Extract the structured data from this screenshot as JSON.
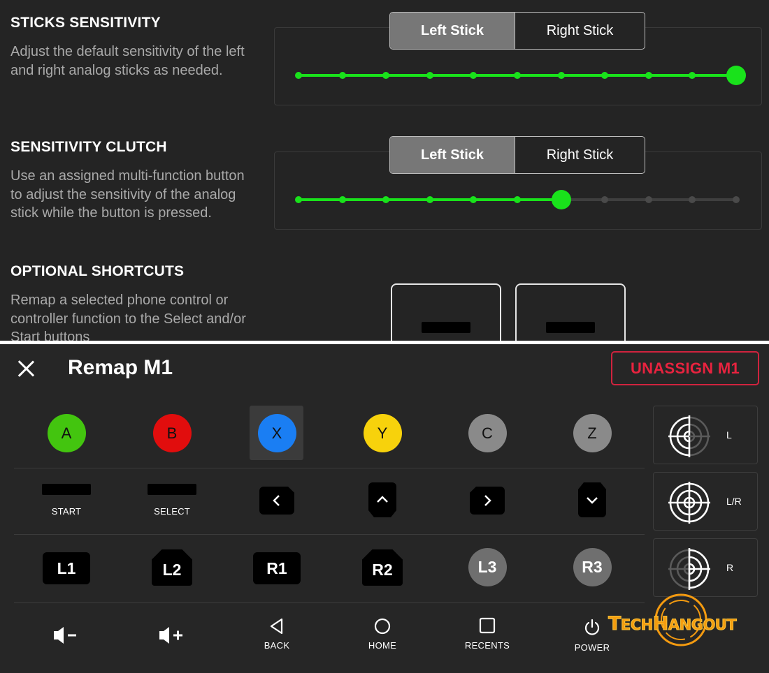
{
  "settings": {
    "sticks_sensitivity": {
      "title": "STICKS SENSITIVITY",
      "description": "Adjust the default sensitivity of the left and right analog sticks as needed.",
      "tabs": [
        "Left Stick",
        "Right Stick"
      ],
      "selected_tab": "Left Stick",
      "level": 10,
      "max_level": 10
    },
    "sensitivity_clutch": {
      "title": "SENSITIVITY CLUTCH",
      "description": "Use an assigned multi-function button to adjust the sensitivity of the analog stick while the button is pressed.",
      "tabs": [
        "Left Stick",
        "Right Stick"
      ],
      "selected_tab": "Left Stick",
      "level": 6,
      "max_level": 10
    },
    "optional_shortcuts": {
      "title": "OPTIONAL SHORTCUTS",
      "description": "Remap a selected phone control or controller function to the Select and/or Start buttons"
    }
  },
  "remap": {
    "title": "Remap M1",
    "unassign_label": "UNASSIGN M1",
    "face_buttons": [
      {
        "label": "A",
        "color": "#43c50f"
      },
      {
        "label": "B",
        "color": "#e10d0d"
      },
      {
        "label": "X",
        "color": "#1a7ef3"
      },
      {
        "label": "Y",
        "color": "#f7d20c"
      },
      {
        "label": "C",
        "color": "#8a8a8a"
      },
      {
        "label": "Z",
        "color": "#8a8a8a"
      }
    ],
    "selected_button": "X",
    "row2": {
      "start": "START",
      "select": "SELECT"
    },
    "shoulders": [
      "L1",
      "L2",
      "R1",
      "R2",
      "L3",
      "R3"
    ],
    "nav": {
      "back": "BACK",
      "home": "HOME",
      "recents": "RECENTS",
      "power": "POWER"
    },
    "side": [
      "L",
      "L/R",
      "R"
    ]
  },
  "watermark": "TECHHANGOUT",
  "colors": {
    "accent_green": "#19e21b",
    "danger": "#e8233f",
    "inactive_track": "#3f3f3f"
  }
}
